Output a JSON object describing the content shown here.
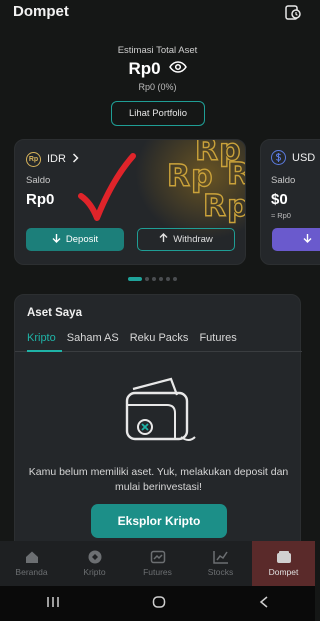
{
  "header": {
    "title": "Dompet"
  },
  "summary": {
    "label": "Estimasi Total Aset",
    "value": "Rp0",
    "change": "Rp0 (0%)",
    "portfolio_btn": "Lihat Portfolio"
  },
  "card_idr": {
    "currency": "IDR",
    "icon_text": "Rp",
    "balance_label": "Saldo",
    "balance": "Rp0",
    "deposit": "Deposit",
    "withdraw": "Withdraw",
    "deco_text": "Rp"
  },
  "card_usd": {
    "currency": "USD",
    "balance_label": "Saldo",
    "balance": "$0",
    "sub": "≈ Rp0"
  },
  "carousel": {
    "total": 6,
    "active": 0
  },
  "assets": {
    "title": "Aset Saya",
    "tabs": [
      "Kripto",
      "Saham AS",
      "Reku Packs",
      "Futures"
    ],
    "active_tab": 0,
    "empty_text": "Kamu belum memiliki aset. Yuk, melakukan deposit dan mulai berinvestasi!",
    "explore_btn": "Eksplor Kripto"
  },
  "bottom_nav": [
    {
      "label": "Beranda",
      "icon": "home-icon"
    },
    {
      "label": "Kripto",
      "icon": "crypto-icon"
    },
    {
      "label": "Futures",
      "icon": "futures-icon"
    },
    {
      "label": "Stocks",
      "icon": "stocks-icon"
    },
    {
      "label": "Dompet",
      "icon": "wallet-icon"
    }
  ],
  "active_nav": 4,
  "colors": {
    "accent": "#1fb3a7",
    "button": "#1c8f88",
    "check": "#e0242a",
    "gold": "#caa23a"
  }
}
